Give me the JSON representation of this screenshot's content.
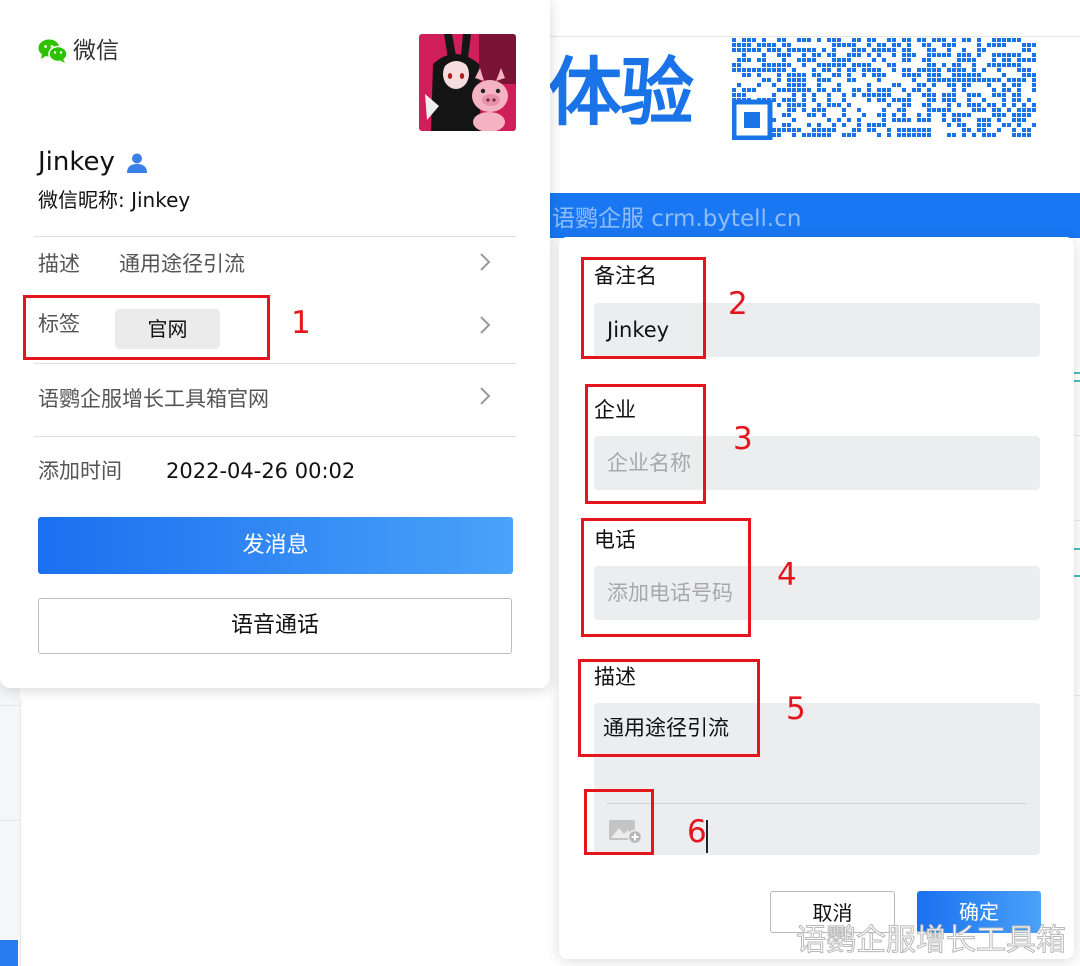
{
  "background": {
    "banner_text": "体验",
    "banner_bar_text": "语鹦企服 crm.bytell.cn",
    "watermark": "语鹦企服增长工具箱"
  },
  "profile_card": {
    "app_title": "微信",
    "contact_name": "Jinkey",
    "nickname_line": "微信昵称: Jinkey",
    "rows": {
      "description_label": "描述",
      "description_value": "通用途径引流",
      "tag_label": "标签",
      "tag_value": "官网",
      "source_label": "语鹦企服增长工具箱官网",
      "add_time_label": "添加时间",
      "add_time_value": "2022-04-26 00:02"
    },
    "send_message_label": "发消息",
    "voice_call_label": "语音通话"
  },
  "edit_dialog": {
    "remark_label": "备注名",
    "remark_value": "Jinkey",
    "company_label": "企业",
    "company_placeholder": "企业名称",
    "phone_label": "电话",
    "phone_placeholder": "添加电话号码",
    "description_label": "描述",
    "description_value": "通用途径引流",
    "cancel_label": "取消",
    "confirm_label": "确定"
  },
  "annotations": [
    "1",
    "2",
    "3",
    "4",
    "5",
    "6"
  ],
  "colors": {
    "primary_blue": "#1a70ef",
    "annotation_red": "#e5151d",
    "wechat_green": "#2dc100",
    "input_bg": "#ecedef"
  },
  "icons": {
    "app_logo": "wechat-logo-icon",
    "contact_type": "person-icon",
    "row_arrow": "chevron-right-icon",
    "add_image": "image-add-icon"
  }
}
